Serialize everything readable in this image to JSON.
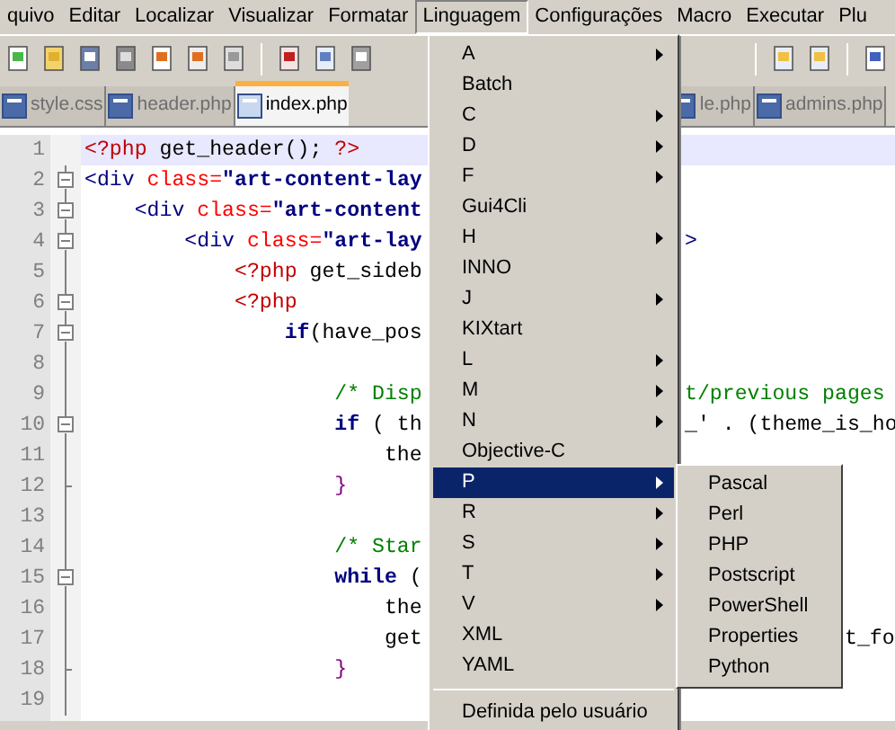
{
  "menu_bar": [
    {
      "label": "quivo",
      "selected": false
    },
    {
      "label": "Editar",
      "selected": false
    },
    {
      "label": "Localizar",
      "selected": false
    },
    {
      "label": "Visualizar",
      "selected": false
    },
    {
      "label": "Formatar",
      "selected": false
    },
    {
      "label": "Linguagem",
      "selected": true
    },
    {
      "label": "Configurações",
      "selected": false
    },
    {
      "label": "Macro",
      "selected": false
    },
    {
      "label": "Executar",
      "selected": false
    },
    {
      "label": "Plu",
      "selected": false
    }
  ],
  "tabs": [
    {
      "label": "style.css",
      "selected": false,
      "kind": "before"
    },
    {
      "label": "header.php",
      "selected": false,
      "kind": "before"
    },
    {
      "label": "index.php",
      "selected": true,
      "kind": "before"
    },
    {
      "label": "le.php",
      "selected": false,
      "kind": "after"
    },
    {
      "label": "admins.php",
      "selected": false,
      "kind": "after"
    }
  ],
  "editor": {
    "lines": [
      {
        "number": "1",
        "current": true,
        "tokens": [
          {
            "kind": "php",
            "text": "<?php"
          },
          {
            "kind": "plain",
            "text": " get_header(); "
          },
          {
            "kind": "php",
            "text": "?>"
          }
        ]
      },
      {
        "number": "2",
        "current": false,
        "fold": {
          "kind": "box"
        },
        "tokens": [
          {
            "kind": "tag",
            "text": "<div "
          },
          {
            "kind": "attr",
            "text": "class="
          },
          {
            "kind": "string",
            "text": "\"art-content-lay"
          }
        ]
      },
      {
        "number": "3",
        "current": false,
        "fold": {
          "kind": "box"
        },
        "tokens": [
          {
            "kind": "tag",
            "text": "    <div "
          },
          {
            "kind": "attr",
            "text": "class="
          },
          {
            "kind": "string",
            "text": "\"art-content"
          }
        ]
      },
      {
        "number": "4",
        "current": false,
        "fold": {
          "kind": "box"
        },
        "tokens": [
          {
            "kind": "tag",
            "text": "        <div "
          },
          {
            "kind": "attr",
            "text": "class="
          },
          {
            "kind": "string",
            "text": "\"art-lay"
          }
        ],
        "right": {
          "kind": "after_menu",
          "tokens": [
            {
              "kind": "tag",
              "text": ">"
            }
          ]
        }
      },
      {
        "number": "5",
        "current": false,
        "fold": {
          "kind": "line"
        },
        "tokens": [
          {
            "kind": "php",
            "text": "            <?php"
          },
          {
            "kind": "plain",
            "text": " get_sideb"
          }
        ]
      },
      {
        "number": "6",
        "current": false,
        "fold": {
          "kind": "box"
        },
        "tokens": [
          {
            "kind": "php",
            "text": "            <?php"
          }
        ]
      },
      {
        "number": "7",
        "current": false,
        "fold": {
          "kind": "box"
        },
        "tokens": [
          {
            "kind": "keyword",
            "text": "                if"
          },
          {
            "kind": "plain",
            "text": "(have_pos"
          }
        ]
      },
      {
        "number": "8",
        "current": false,
        "fold": {
          "kind": "line"
        }
      },
      {
        "number": "9",
        "current": false,
        "fold": {
          "kind": "line"
        },
        "tokens": [
          {
            "kind": "comment",
            "text": "                    /* Disp"
          }
        ],
        "right": {
          "kind": "after_menu",
          "tokens": [
            {
              "kind": "comment",
              "text": "t/previous pages"
            }
          ]
        }
      },
      {
        "number": "10",
        "current": false,
        "fold": {
          "kind": "box"
        },
        "tokens": [
          {
            "kind": "keyword",
            "text": "                    if"
          },
          {
            "kind": "plain",
            "text": " ( th"
          }
        ],
        "right": {
          "kind": "after_menu",
          "tokens": [
            {
              "kind": "plain",
              "text": "_' . (theme_is_ho"
            }
          ]
        }
      },
      {
        "number": "11",
        "current": false,
        "fold": {
          "kind": "line"
        },
        "tokens": [
          {
            "kind": "plain",
            "text": "                        the"
          }
        ]
      },
      {
        "number": "12",
        "current": false,
        "fold": {
          "kind": "end"
        },
        "tokens": [
          {
            "kind": "brace",
            "text": "                    }"
          }
        ]
      },
      {
        "number": "13",
        "current": false,
        "fold": {
          "kind": "line"
        }
      },
      {
        "number": "14",
        "current": false,
        "fold": {
          "kind": "line"
        },
        "tokens": [
          {
            "kind": "comment",
            "text": "                    /* Star"
          }
        ]
      },
      {
        "number": "15",
        "current": false,
        "fold": {
          "kind": "box"
        },
        "tokens": [
          {
            "kind": "keyword",
            "text": "                    while"
          },
          {
            "kind": "plain",
            "text": " ("
          }
        ]
      },
      {
        "number": "16",
        "current": false,
        "fold": {
          "kind": "line"
        },
        "tokens": [
          {
            "kind": "plain",
            "text": "                        the"
          }
        ]
      },
      {
        "number": "17",
        "current": false,
        "fold": {
          "kind": "line"
        },
        "tokens": [
          {
            "kind": "plain",
            "text": "                        get"
          }
        ],
        "right": {
          "kind": "after_submenu",
          "tokens": [
            {
              "kind": "plain",
              "text": "t_fo"
            }
          ]
        }
      },
      {
        "number": "18",
        "current": false,
        "fold": {
          "kind": "end"
        },
        "tokens": [
          {
            "kind": "brace",
            "text": "                    }"
          }
        ]
      },
      {
        "number": "19",
        "current": false,
        "fold": {
          "kind": "line"
        }
      }
    ]
  },
  "language_menu": {
    "items": [
      {
        "label": "A",
        "submenu": true,
        "selected": false
      },
      {
        "label": "Batch",
        "submenu": false,
        "selected": false
      },
      {
        "label": "C",
        "submenu": true,
        "selected": false
      },
      {
        "label": "D",
        "submenu": true,
        "selected": false
      },
      {
        "label": "F",
        "submenu": true,
        "selected": false
      },
      {
        "label": "Gui4Cli",
        "submenu": false,
        "selected": false
      },
      {
        "label": "H",
        "submenu": true,
        "selected": false
      },
      {
        "label": "INNO",
        "submenu": false,
        "selected": false
      },
      {
        "label": "J",
        "submenu": true,
        "selected": false
      },
      {
        "label": "KIXtart",
        "submenu": false,
        "selected": false
      },
      {
        "label": "L",
        "submenu": true,
        "selected": false
      },
      {
        "label": "M",
        "submenu": true,
        "selected": false
      },
      {
        "label": "N",
        "submenu": true,
        "selected": false
      },
      {
        "label": "Objective-C",
        "submenu": false,
        "selected": false
      },
      {
        "label": "P",
        "submenu": true,
        "selected": true
      },
      {
        "label": "R",
        "submenu": true,
        "selected": false
      },
      {
        "label": "S",
        "submenu": true,
        "selected": false
      },
      {
        "label": "T",
        "submenu": true,
        "selected": false
      },
      {
        "label": "V",
        "submenu": true,
        "selected": false
      },
      {
        "label": "XML",
        "submenu": false,
        "selected": false
      },
      {
        "label": "YAML",
        "submenu": false,
        "selected": false
      }
    ],
    "footer_item": "Definida pelo usuário"
  },
  "p_submenu": {
    "items": [
      "Pascal",
      "Perl",
      "PHP",
      "Postscript",
      "PowerShell",
      "Properties",
      "Python"
    ]
  }
}
